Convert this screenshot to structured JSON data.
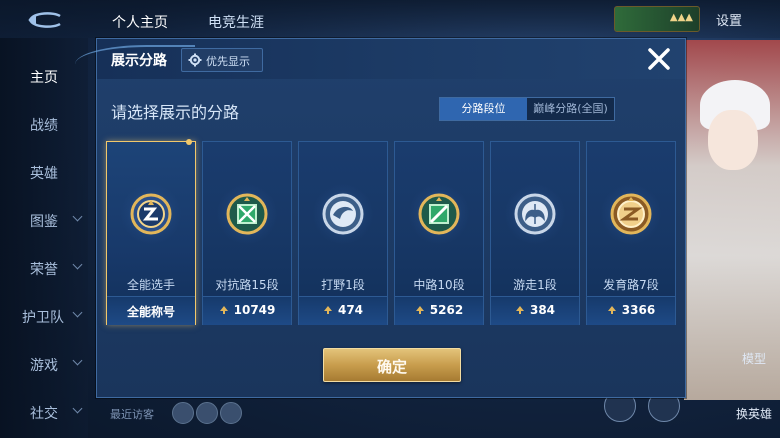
{
  "top_tabs": [
    "个人主页",
    "电竞生涯"
  ],
  "settings_label": "设置",
  "sidebar": {
    "items": [
      {
        "label": "主页",
        "chevron": false,
        "active": true
      },
      {
        "label": "战绩",
        "chevron": false
      },
      {
        "label": "英雄",
        "chevron": false
      },
      {
        "label": "图鉴",
        "chevron": true
      },
      {
        "label": "荣誉",
        "chevron": true
      },
      {
        "label": "护卫队",
        "chevron": true
      },
      {
        "label": "游戏",
        "chevron": true
      },
      {
        "label": "社交",
        "chevron": true
      }
    ]
  },
  "recent_visitors_label": "最近访客",
  "right_panel": {
    "model_label": "模型",
    "change_hero_label": "换英雄"
  },
  "dialog": {
    "title": "展示分路",
    "priority_label": "优先显示",
    "prompt": "请选择展示的分路",
    "toggle": [
      "分路段位",
      "巅峰分路(全国)"
    ],
    "cards": [
      {
        "name": "全能选手",
        "value": "全能称号",
        "selected": true,
        "emblem": "all-round-emblem-icon",
        "color": "#d8a64a"
      },
      {
        "name": "对抗路15段",
        "value": "10749",
        "selected": false,
        "emblem": "clash-lane-emblem-icon",
        "color": "#4fc37a"
      },
      {
        "name": "打野1段",
        "value": "474",
        "selected": false,
        "emblem": "jungle-emblem-icon",
        "color": "#c8d6e8"
      },
      {
        "name": "中路10段",
        "value": "5262",
        "selected": false,
        "emblem": "mid-lane-emblem-icon",
        "color": "#4fc37a"
      },
      {
        "name": "游走1段",
        "value": "384",
        "selected": false,
        "emblem": "roam-emblem-icon",
        "color": "#c8d6e8"
      },
      {
        "name": "发育路7段",
        "value": "3366",
        "selected": false,
        "emblem": "farm-lane-emblem-icon",
        "color": "#d8a64a"
      }
    ],
    "confirm_label": "确定"
  },
  "colors": {
    "accent_gold": "#f1c86b",
    "panel_blue": "#1a355c",
    "toggle_active": "#2f66b0"
  }
}
